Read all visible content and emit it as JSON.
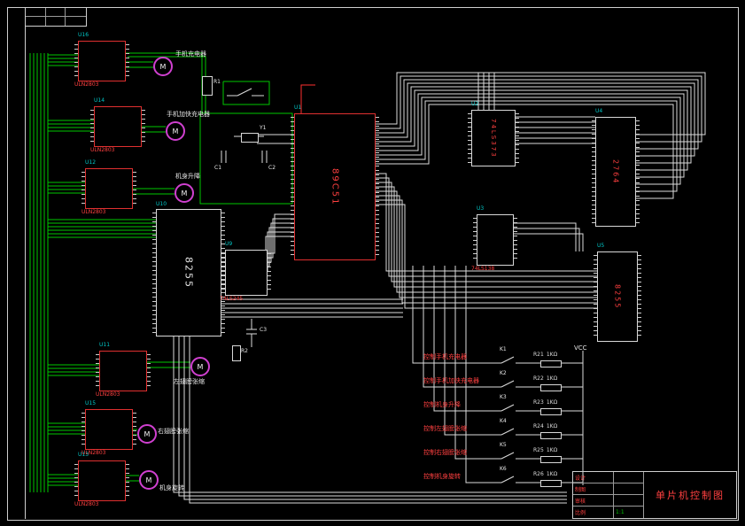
{
  "drawing": {
    "kind": "单片机控制电路图"
  },
  "mcu": {
    "des": "U1",
    "label": "89C51"
  },
  "chips": {
    "pio_left": {
      "des": "U10",
      "label": "8255"
    },
    "buffer": {
      "des": "U9",
      "label": "74LS245"
    },
    "latch": {
      "des": "U2",
      "label": "74LS373"
    },
    "decoder": {
      "des": "U3",
      "label": "74LS138"
    },
    "eprom": {
      "des": "U4",
      "label": "2764"
    },
    "pio_right": {
      "des": "U5",
      "label": "8255"
    }
  },
  "modules": [
    {
      "des": "U16",
      "chip": "ULN2803",
      "motor": "M",
      "caption": "手机充电器"
    },
    {
      "des": "U14",
      "chip": "ULN2803",
      "motor": "M",
      "caption": "手机加快充电器"
    },
    {
      "des": "U12",
      "chip": "ULN2803",
      "motor": "M",
      "caption": "机身升降"
    },
    {
      "des": "U11",
      "chip": "ULN2803",
      "motor": "M",
      "caption": "左翅膀张缩"
    },
    {
      "des": "U15",
      "chip": "ULN2803",
      "motor": "M",
      "caption": "右翅膀张缩"
    },
    {
      "des": "U13",
      "chip": "ULN2803",
      "motor": "M",
      "caption": "机身旋转"
    }
  ],
  "osc": {
    "r1": "R1",
    "r2": "R2",
    "y1": "Y1",
    "c1": "C1",
    "c2": "C2",
    "c3": "C3"
  },
  "relay": {
    "vcc": "VCC",
    "rows": [
      {
        "label": "控制手机充电器",
        "sw": "K1",
        "res": "R21",
        "val": "1KΩ"
      },
      {
        "label": "控制手机加快充电器",
        "sw": "K2",
        "res": "R22",
        "val": "1KΩ"
      },
      {
        "label": "控制机身升降",
        "sw": "K3",
        "res": "R23",
        "val": "1KΩ"
      },
      {
        "label": "控制左翅膀张缩",
        "sw": "K4",
        "res": "R24",
        "val": "1KΩ"
      },
      {
        "label": "控制右翅膀张缩",
        "sw": "K5",
        "res": "R25",
        "val": "1KΩ"
      },
      {
        "label": "控制机身旋转",
        "sw": "K6",
        "res": "R26",
        "val": "1KΩ"
      }
    ]
  },
  "titleblock": {
    "title": "单片机控制图",
    "cells": [
      "设计",
      "制图",
      "审核",
      "比例"
    ],
    "scale": "1:1"
  }
}
